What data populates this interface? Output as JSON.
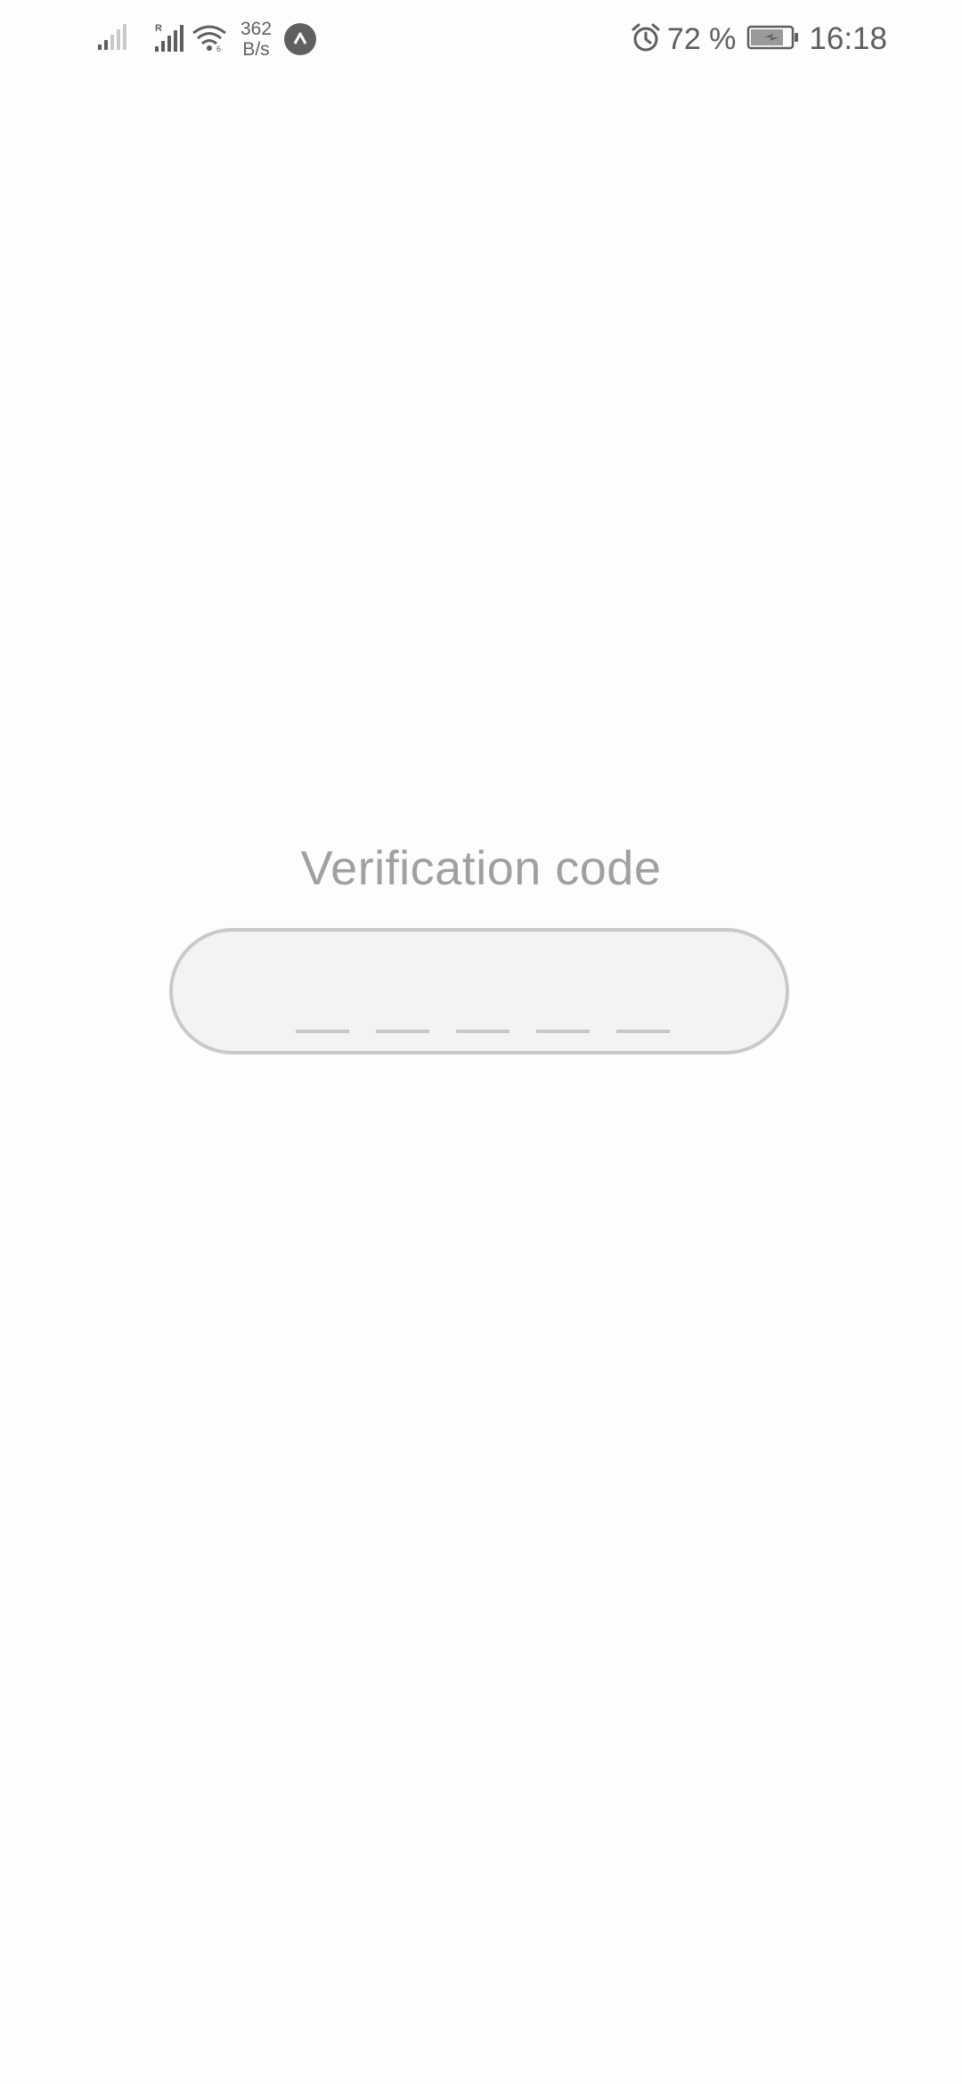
{
  "status_bar": {
    "net_speed_value": "362",
    "net_speed_unit": "B/s",
    "battery_percent": "72 %",
    "time": "16:18",
    "icons": [
      "signal-weak-icon",
      "signal-roaming-icon",
      "wifi-icon",
      "app-notification-icon",
      "alarm-icon",
      "battery-charging-icon"
    ]
  },
  "verification": {
    "title": "Verification code",
    "code_length": 5
  },
  "colors": {
    "title_text": "#a0a0a0",
    "input_border": "#c9c9c9",
    "input_fill": "#f3f3f3",
    "slot_line": "#c8c8c8",
    "status_icons": "#5e5e5e"
  }
}
